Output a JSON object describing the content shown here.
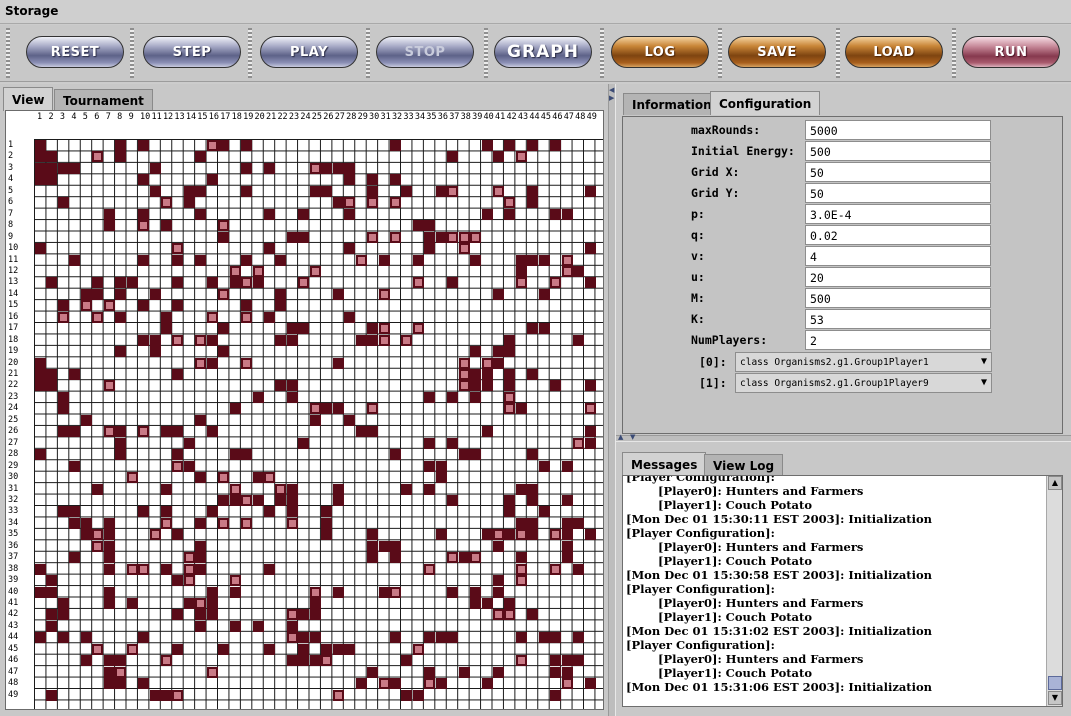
{
  "window": {
    "title": "Storage"
  },
  "toolbar": {
    "buttons": [
      {
        "label": "RESET",
        "style": "steel"
      },
      {
        "label": "STEP",
        "style": "steel"
      },
      {
        "label": "PLAY",
        "style": "steel"
      },
      {
        "label": "STOP",
        "style": "steel",
        "disabled": true
      },
      {
        "label": "GRAPH",
        "style": "steel"
      },
      {
        "label": "LOG",
        "style": "bronze"
      },
      {
        "label": "SAVE",
        "style": "bronze"
      },
      {
        "label": "LOAD",
        "style": "bronze"
      },
      {
        "label": "RUN",
        "style": "marble"
      }
    ]
  },
  "left_tabs": [
    {
      "label": "View",
      "active": true
    },
    {
      "label": "Tournament",
      "active": false
    }
  ],
  "grid": {
    "columns": [
      "1",
      "2",
      "3",
      "4",
      "5",
      "6",
      "7",
      "8",
      "9",
      "10",
      "11",
      "12",
      "13",
      "14",
      "15",
      "16",
      "17",
      "18",
      "19",
      "20",
      "21",
      "22",
      "23",
      "24",
      "25",
      "26",
      "27",
      "28",
      "29",
      "30",
      "31",
      "32",
      "33",
      "34",
      "35",
      "36",
      "37",
      "38",
      "39",
      "40",
      "41",
      "42",
      "43",
      "44",
      "45",
      "46",
      "47",
      "48",
      "49"
    ],
    "rows": [
      "1",
      "2",
      "3",
      "4",
      "5",
      "6",
      "7",
      "8",
      "9",
      "10",
      "11",
      "12",
      "13",
      "14",
      "15",
      "16",
      "17",
      "18",
      "19",
      "20",
      "21",
      "22",
      "23",
      "24",
      "25",
      "26",
      "27",
      "28",
      "29",
      "30",
      "31",
      "32",
      "33",
      "34",
      "35",
      "36",
      "37",
      "38",
      "39",
      "40",
      "41",
      "42",
      "43",
      "44",
      "45",
      "46",
      "47",
      "48",
      "49"
    ],
    "colors": {
      "organism_dark": "#5a0b18",
      "organism_pink": "#c97a86"
    }
  },
  "right_tabs_top": [
    {
      "label": "Information",
      "active": false
    },
    {
      "label": "Configuration",
      "active": true
    }
  ],
  "config": {
    "fields": [
      {
        "label": "maxRounds:",
        "value": "5000"
      },
      {
        "label": "Initial Energy:",
        "value": "500"
      },
      {
        "label": "Grid X:",
        "value": "50"
      },
      {
        "label": "Grid Y:",
        "value": "50"
      },
      {
        "label": "p:",
        "value": "3.0E-4"
      },
      {
        "label": "q:",
        "value": "0.02"
      },
      {
        "label": "v:",
        "value": "4"
      },
      {
        "label": "u:",
        "value": "20"
      },
      {
        "label": "M:",
        "value": "500"
      },
      {
        "label": "K:",
        "value": "53"
      },
      {
        "label": "NumPlayers:",
        "value": "2"
      }
    ],
    "players": [
      {
        "label": "[0]:",
        "value": "class Organisms2.g1.Group1Player1"
      },
      {
        "label": "[1]:",
        "value": "class Organisms2.g1.Group1Player9"
      }
    ]
  },
  "right_tabs_bottom": [
    {
      "label": "Messages",
      "active": true
    },
    {
      "label": "View Log",
      "active": false
    }
  ],
  "messages": [
    "[Player Configuration]:",
    "        [Player0]: Hunters and Farmers",
    "        [Player1]: Couch Potato",
    "[Mon Dec 01 15:30:11 EST 2003]: Initialization",
    "[Player Configuration]:",
    "        [Player0]: Hunters and Farmers",
    "        [Player1]: Couch Potato",
    "[Mon Dec 01 15:30:58 EST 2003]: Initialization",
    "[Player Configuration]:",
    "        [Player0]: Hunters and Farmers",
    "        [Player1]: Couch Potato",
    "[Mon Dec 01 15:31:02 EST 2003]: Initialization",
    "[Player Configuration]:",
    "        [Player0]: Hunters and Farmers",
    "        [Player1]: Couch Potato",
    "[Mon Dec 01 15:31:06 EST 2003]: Initialization"
  ]
}
